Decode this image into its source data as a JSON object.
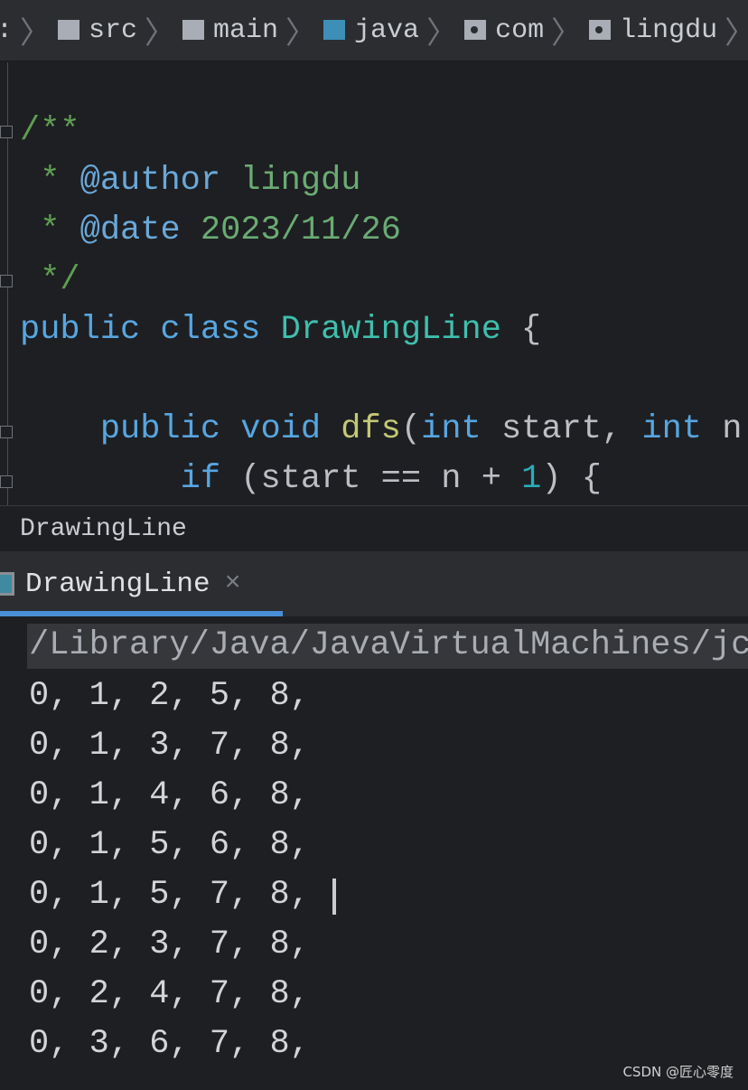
{
  "breadcrumb": {
    "items": [
      {
        "label": "src",
        "icon": "folder-icon"
      },
      {
        "label": "main",
        "icon": "folder-icon"
      },
      {
        "label": "java",
        "icon": "source-folder-icon"
      },
      {
        "label": "com",
        "icon": "package-icon"
      },
      {
        "label": "lingdu",
        "icon": "package-icon"
      }
    ],
    "leading": ":"
  },
  "editor": {
    "lines": [
      {
        "parts": [
          [
            "c",
            "/**"
          ]
        ]
      },
      {
        "parts": [
          [
            "c",
            " * "
          ],
          [
            "tag",
            "@author"
          ],
          [
            "t",
            " lingdu"
          ]
        ]
      },
      {
        "parts": [
          [
            "c",
            " * "
          ],
          [
            "tag",
            "@date"
          ],
          [
            "t",
            " 2023/11/26"
          ]
        ]
      },
      {
        "parts": [
          [
            "c",
            " */"
          ]
        ]
      },
      {
        "parts": [
          [
            "kw",
            "public class "
          ],
          [
            "cls",
            "DrawingLine"
          ],
          [
            "",
            "{"
          ]
        ]
      },
      {
        "parts": []
      },
      {
        "parts": [
          [
            "kw",
            "    public void "
          ],
          [
            "fnn",
            "dfs"
          ],
          [
            "",
            "("
          ],
          [
            "kw",
            "int"
          ],
          [
            "",
            " start, "
          ],
          [
            "kw",
            "int"
          ],
          [
            "",
            " n"
          ]
        ]
      },
      {
        "parts": [
          [
            "kw",
            "        if"
          ],
          [
            "",
            " (start == n + "
          ],
          [
            "num",
            "1"
          ],
          [
            "",
            ") {"
          ]
        ]
      }
    ]
  },
  "structure_bar": {
    "label": "DrawingLine"
  },
  "run_tab": {
    "label": "DrawingLine",
    "close": "×"
  },
  "console": {
    "command": "/Library/Java/JavaVirtualMachines/jc",
    "output": [
      "0, 1, 2, 5, 8,",
      "0, 1, 3, 7, 8,",
      "0, 1, 4, 6, 8,",
      "0, 1, 5, 6, 8,",
      "0, 1, 5, 7, 8,",
      "0, 2, 3, 7, 8,",
      "0, 2, 4, 7, 8,",
      "0, 3, 6, 7, 8,"
    ]
  },
  "watermark": "CSDN @匠心零度"
}
